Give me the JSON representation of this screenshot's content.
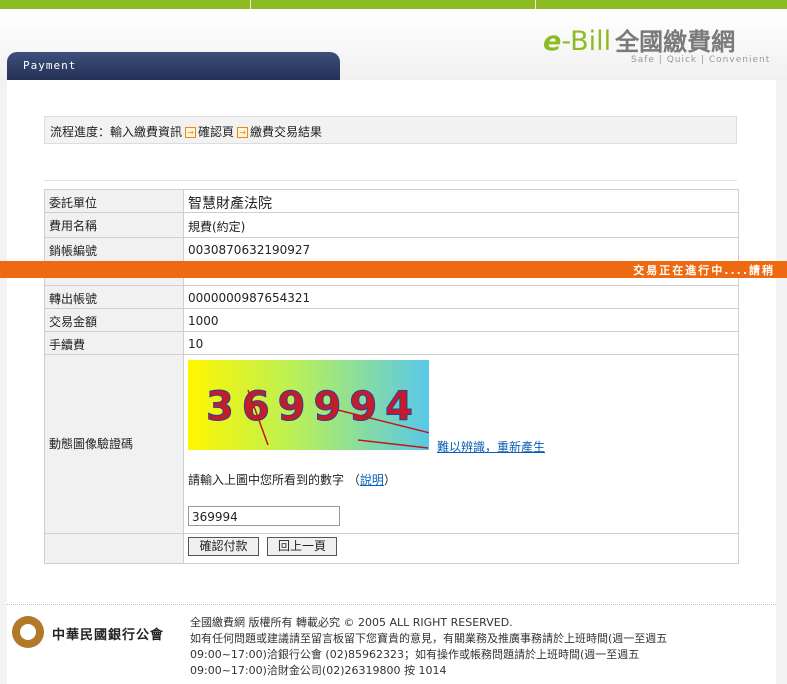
{
  "brand": {
    "logo_e": "e",
    "logo_bill": "-Bill",
    "logo_cn": "全國繳費網",
    "tagline": "Safe | Quick | Convenient",
    "accent": "#8dbb23"
  },
  "tab": {
    "title": "Payment"
  },
  "progress": {
    "prefix": "流程進度：",
    "step1": "輸入繳費資訊",
    "step2": "確認頁",
    "step3": "繳費交易結果",
    "arrow_icon": "orange-arrow-icon"
  },
  "form": {
    "agency_label": "委託單位",
    "agency_value": "智慧財產法院",
    "fee_label": "費用名稱",
    "fee_value": "規費(約定)",
    "account_label": "銷帳編號",
    "account_value": "0030870632190927",
    "transfer_label": "轉出帳號",
    "transfer_value": "0000000987654321",
    "amount_label": "交易金額",
    "amount_value": "1000",
    "handling_label": "手續費",
    "handling_value": "10",
    "captcha_label": "動態圖像驗證碼",
    "captcha_digits": [
      "3",
      "6",
      "9",
      "9",
      "9",
      "4"
    ],
    "regen_link": "難以辨識，重新產生",
    "hint_text": "請輸入上圖中您所看到的數字 （",
    "hint_link": "說明",
    "hint_close": "）",
    "captcha_input": "369994",
    "confirm_button": "確認付款",
    "back_button": "回上一頁"
  },
  "processing": {
    "text": "交易正在進行中....請稍",
    "color": "#ee6a12"
  },
  "footer": {
    "bank_name": "中華民國銀行公會",
    "line1": "全國繳費網 版權所有 轉載必究 © 2005 ALL RIGHT RESERVED.",
    "line2": "如有任何問題或建議請至留言板留下您寶貴的意見，有關業務及推廣事務請於上班時間(週一至週五",
    "line3": "09:00~17:00)洽銀行公會 (02)85962323；如有操作或帳務問題請於上班時間(週一至週五",
    "line4": "09:00~17:00)洽財金公司(02)26319800 按 1014"
  }
}
